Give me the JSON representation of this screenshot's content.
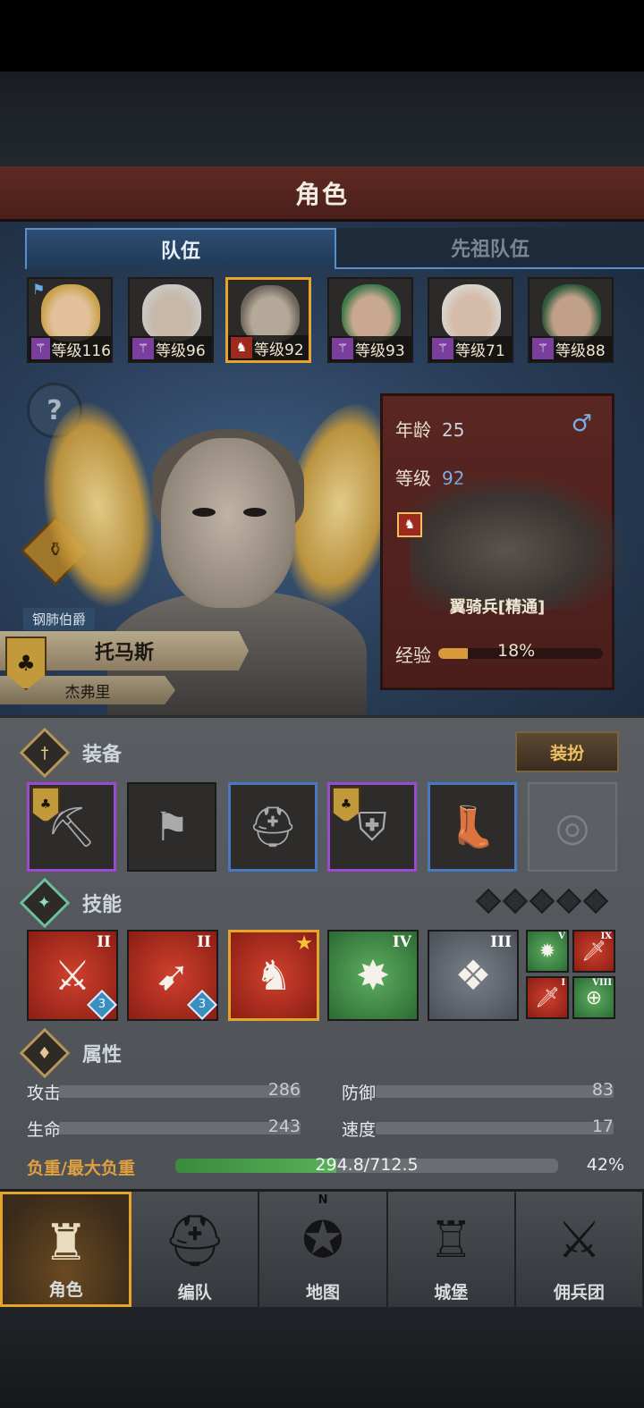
{
  "header": {
    "title": "角色"
  },
  "tabs": [
    {
      "label": "队伍",
      "active": true
    },
    {
      "label": "先祖队伍",
      "active": false
    }
  ],
  "roster": [
    {
      "level_text": "等级116",
      "class_icon": "staff-icon",
      "flag": true,
      "selected": false,
      "hair": "#c9a24a",
      "skin": "#e2c09a"
    },
    {
      "level_text": "等级96",
      "class_icon": "staff-icon",
      "flag": false,
      "selected": false,
      "hair": "#c8c8c4",
      "skin": "#c8b8a8"
    },
    {
      "level_text": "等级92",
      "class_icon": "horse-icon",
      "flag": false,
      "selected": true,
      "hair": "#6e665c",
      "skin": "#b4a898"
    },
    {
      "level_text": "等级93",
      "class_icon": "staff-icon",
      "flag": false,
      "selected": false,
      "hair": "#3f7a4a",
      "skin": "#c8a890"
    },
    {
      "level_text": "等级71",
      "class_icon": "staff-icon",
      "flag": false,
      "selected": false,
      "hair": "#d8d4cc",
      "skin": "#d4bca8"
    },
    {
      "level_text": "等级88",
      "class_icon": "staff-icon",
      "flag": false,
      "selected": false,
      "hair": "#2c5a3a",
      "skin": "#c0a088"
    }
  ],
  "character": {
    "title": "钢肺伯爵",
    "name": "托马斯",
    "subtitle": "杰弗里",
    "age_label": "年龄",
    "age": "25",
    "gender_icon": "male-icon",
    "level_label": "等级",
    "level": "92",
    "unit_name": "翼骑兵[精通]",
    "exp_label": "经验",
    "exp_percent": 18,
    "exp_text": "18%"
  },
  "equipment": {
    "title": "装备",
    "dress_button": "装扮",
    "slots": [
      {
        "icon": "pickaxe-icon",
        "rarity": "purple",
        "crest": true
      },
      {
        "icon": "banner-icon",
        "rarity": "grey",
        "crest": false
      },
      {
        "icon": "helmet-icon",
        "rarity": "blue",
        "crest": false
      },
      {
        "icon": "armor-icon",
        "rarity": "purple",
        "crest": true
      },
      {
        "icon": "boots-icon",
        "rarity": "blue",
        "crest": false
      },
      {
        "icon": "ring-icon",
        "rarity": "empty",
        "crest": false
      }
    ]
  },
  "skills": {
    "title": "技能",
    "pip_count": 5,
    "main": [
      {
        "icon": "sword-strike-icon",
        "color": "red",
        "rank": "II",
        "level": "3"
      },
      {
        "icon": "charge-icon",
        "color": "red",
        "rank": "II",
        "level": "3"
      },
      {
        "icon": "horse-banner-icon",
        "color": "red",
        "rank": "",
        "level": "",
        "star": true
      },
      {
        "icon": "crystal-burst-icon",
        "color": "green",
        "rank": "IV",
        "level": ""
      },
      {
        "icon": "crystal-shield-icon",
        "color": "grey",
        "rank": "III",
        "level": ""
      }
    ],
    "mini": [
      {
        "icon": "burst-icon",
        "color": "green",
        "rank": "V"
      },
      {
        "icon": "sword-icon",
        "color": "red",
        "rank": "IX"
      },
      {
        "icon": "sword-icon",
        "color": "red",
        "rank": "I"
      },
      {
        "icon": "target-icon",
        "color": "green",
        "rank": "VIII"
      }
    ]
  },
  "attributes": {
    "title": "属性",
    "stats": [
      {
        "label": "攻击",
        "value": "286"
      },
      {
        "label": "防御",
        "value": "83"
      },
      {
        "label": "生命",
        "value": "243"
      },
      {
        "label": "速度",
        "value": "17"
      }
    ],
    "load_label": "负重/最大负重",
    "load_text": "294.8/712.5",
    "load_percent": 42,
    "load_percent_text": "42%"
  },
  "nav": [
    {
      "label": "角色",
      "icon": "knight-icon",
      "active": true
    },
    {
      "label": "编队",
      "icon": "helmet-icon",
      "active": false
    },
    {
      "label": "地图",
      "icon": "compass-icon",
      "active": false,
      "compass_n": "N"
    },
    {
      "label": "城堡",
      "icon": "castle-icon",
      "active": false
    },
    {
      "label": "佣兵团",
      "icon": "mercenary-icon",
      "active": false
    }
  ]
}
